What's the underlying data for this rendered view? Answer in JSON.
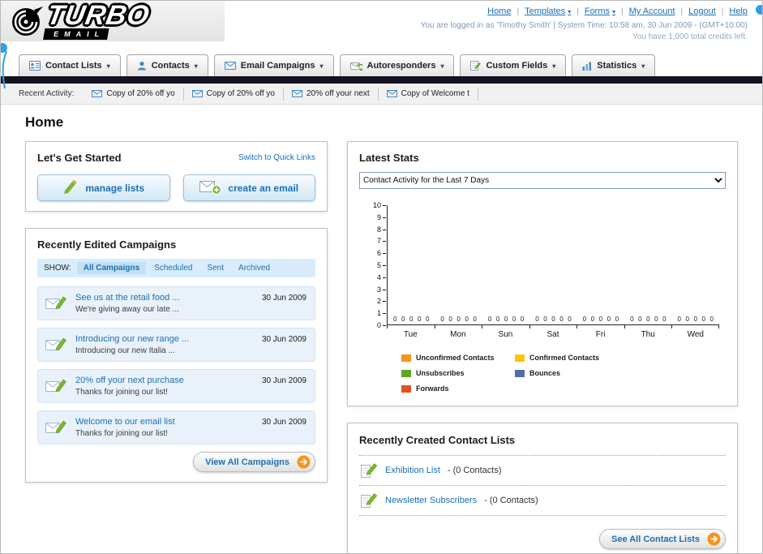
{
  "icons": {
    "dropdown_arrow": "▾",
    "pipe": "|"
  },
  "header": {
    "logo": {
      "title": "TURBO",
      "subtitle": "EMAIL"
    },
    "nav": [
      "Home",
      "Templates",
      "Forms",
      "My Account",
      "Logout",
      "Help"
    ],
    "session_line": "You are logged in as 'Timothy Smith' | System Time: 10:58 am, 30 Jun 2009 - (GMT+10:00)",
    "credits_line": "You have 1,000 total credits left."
  },
  "main_nav": {
    "items": [
      {
        "label": "Contact Lists"
      },
      {
        "label": "Contacts"
      },
      {
        "label": "Email Campaigns"
      },
      {
        "label": "Autoresponders"
      },
      {
        "label": "Custom Fields"
      },
      {
        "label": "Statistics"
      }
    ]
  },
  "recent_activity": {
    "label": "Recent Activity:",
    "items": [
      "Copy of 20% off yo",
      "Copy of 20% off yo",
      "20% off your next",
      "Copy of Welcome t"
    ]
  },
  "page_title": "Home",
  "get_started": {
    "title": "Let's Get Started",
    "switch_link": "Switch to Quick Links",
    "buttons": [
      {
        "label": "manage lists"
      },
      {
        "label": "create an email"
      }
    ]
  },
  "campaigns": {
    "title": "Recently Edited Campaigns",
    "show_label": "SHOW:",
    "tabs": [
      "All Campaigns",
      "Scheduled",
      "Sent",
      "Archived"
    ],
    "items": [
      {
        "title": "See us at the retail food ...",
        "subtitle": "We're giving away our late ...",
        "date": "30 Jun 2009"
      },
      {
        "title": "Introducing our new range ...",
        "subtitle": "Introducing our new Italia ...",
        "date": "30 Jun 2009"
      },
      {
        "title": "20% off your next purchase",
        "subtitle": "Thanks for joining our list!",
        "date": "30 Jun 2009"
      },
      {
        "title": "Welcome to our email list",
        "subtitle": "Thanks for joining our list!",
        "date": "30 Jun 2009"
      }
    ],
    "view_all_label": "View All Campaigns"
  },
  "stats": {
    "title": "Latest Stats",
    "dropdown_value": "Contact Activity for the Last 7 Days",
    "chart_data": {
      "type": "bar",
      "categories": [
        "Tue",
        "Mon",
        "Sun",
        "Sat",
        "Fri",
        "Thu",
        "Wed"
      ],
      "series": [
        {
          "name": "Unconfirmed Contacts",
          "color": "#f7941d",
          "values": [
            0,
            0,
            0,
            0,
            0,
            0,
            0
          ]
        },
        {
          "name": "Confirmed Contacts",
          "color": "#fdc500",
          "values": [
            0,
            0,
            0,
            0,
            0,
            0,
            0
          ]
        },
        {
          "name": "Unsubscribes",
          "color": "#61a521",
          "values": [
            0,
            0,
            0,
            0,
            0,
            0,
            0
          ]
        },
        {
          "name": "Bounces",
          "color": "#4f6fa8",
          "values": [
            0,
            0,
            0,
            0,
            0,
            0,
            0
          ]
        },
        {
          "name": "Forwards",
          "color": "#e8501f",
          "values": [
            0,
            0,
            0,
            0,
            0,
            0,
            0
          ]
        }
      ],
      "ylim": [
        0,
        10
      ],
      "grid": false,
      "legend_position": "bottom"
    }
  },
  "contact_lists": {
    "title": "Recently Created Contact Lists",
    "items": [
      {
        "name": "Exhibition List",
        "detail": "- (0 Contacts)"
      },
      {
        "name": "Newsletter Subscribers",
        "detail": "- (0 Contacts)"
      }
    ],
    "see_all_label": "See All Contact Lists"
  }
}
